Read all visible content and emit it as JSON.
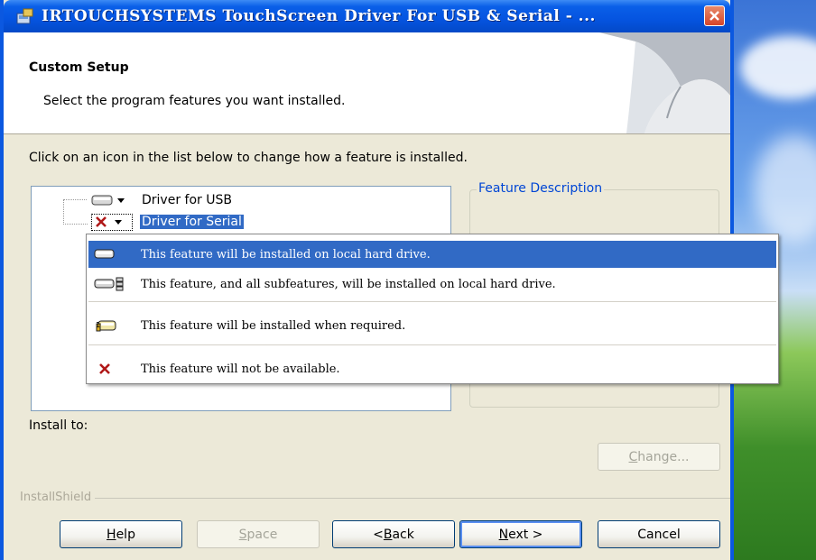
{
  "window": {
    "title": "IRTOUCHSYSTEMS TouchScreen Driver For USB & Serial - ..."
  },
  "header": {
    "title": "Custom Setup",
    "subtitle": "Select the program features you want installed."
  },
  "instruction": "Click on an icon in the list below to change how a feature is installed.",
  "features": [
    {
      "label": "Driver for USB",
      "state_icon": "hard-drive-icon",
      "selected": false
    },
    {
      "label": "Driver for Serial",
      "state_icon": "red-x-icon",
      "selected": true
    }
  ],
  "feature_description": {
    "legend": "Feature Description"
  },
  "install_to_label": "Install to:",
  "popup_menu": [
    {
      "icon": "hard-drive-icon",
      "text": "This feature will be installed on local hard drive.",
      "highlighted": true
    },
    {
      "icon": "hard-drive-subfeatures-icon",
      "text": "This feature, and all subfeatures, will be installed on local hard drive.",
      "highlighted": false
    },
    {
      "icon": "install-on-demand-icon",
      "text": "This feature will be installed when required.",
      "highlighted": false
    },
    {
      "icon": "red-x-icon",
      "text": "This feature will not be available.",
      "highlighted": false
    }
  ],
  "brand": "InstallShield",
  "buttons": {
    "change": {
      "pre": "",
      "mnemonic": "C",
      "post": "hange..."
    },
    "help": {
      "pre": "",
      "mnemonic": "H",
      "post": "elp"
    },
    "space": {
      "pre": "",
      "mnemonic": "S",
      "post": "pace"
    },
    "back": {
      "pre": "< ",
      "mnemonic": "B",
      "post": "ack"
    },
    "next": {
      "pre": "",
      "mnemonic": "N",
      "post": "ext >"
    },
    "cancel": {
      "pre": "",
      "mnemonic": "",
      "post": "Cancel"
    }
  },
  "colors": {
    "titlebar": "#0554e0",
    "selection": "#316ac5",
    "dialog_bg": "#ece9d8",
    "red_x": "#b01818"
  }
}
